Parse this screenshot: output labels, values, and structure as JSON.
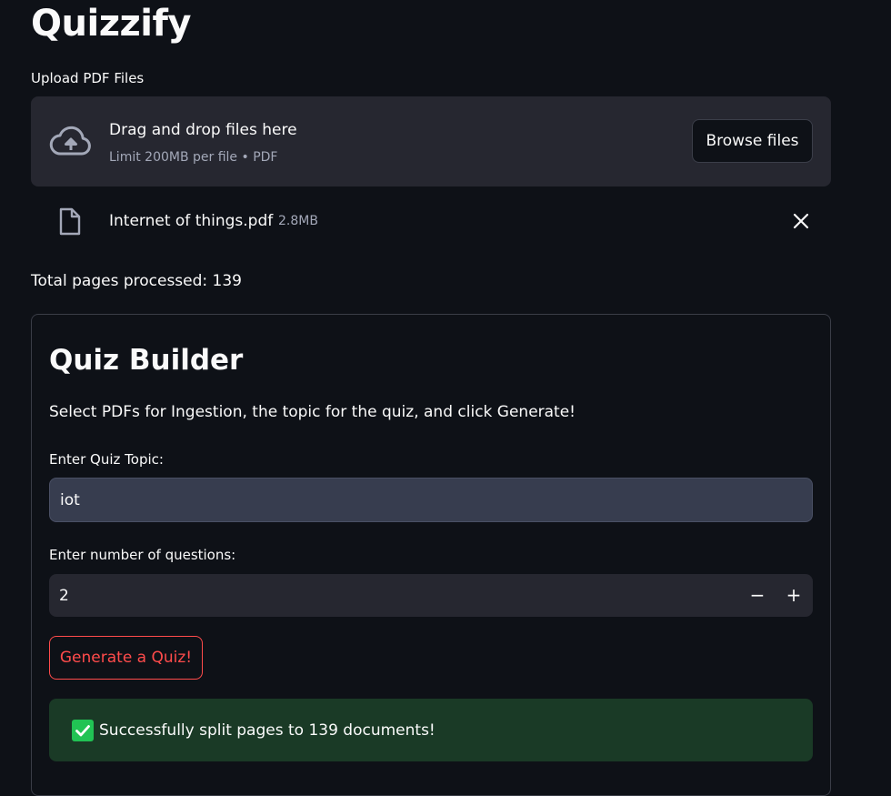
{
  "app": {
    "title": "Quizzify"
  },
  "uploader": {
    "label": "Upload PDF Files",
    "drop_title": "Drag and drop files here",
    "drop_limit": "Limit 200MB per file • PDF",
    "browse_label": "Browse files",
    "icon": "cloud-upload-icon"
  },
  "uploaded_file": {
    "name": "Internet of things.pdf",
    "size": "2.8MB",
    "icon": "file-icon",
    "remove_icon": "close-icon"
  },
  "status": {
    "pages_processed": "Total pages processed: 139"
  },
  "quiz_builder": {
    "title": "Quiz Builder",
    "description": "Select PDFs for Ingestion, the topic for the quiz, and click Generate!",
    "topic_label": "Enter Quiz Topic:",
    "topic_value": "iot",
    "questions_label": "Enter number of questions:",
    "questions_value": "2",
    "decrement_symbol": "−",
    "increment_symbol": "+",
    "generate_label": "Generate a Quiz!",
    "success_message": "Successfully split pages to 139 documents!",
    "success_icon": "check-mark-icon"
  },
  "colors": {
    "background": "#0e1117",
    "surface": "#262730",
    "accent": "#ff4b4b",
    "success_bg": "#1a3a26",
    "success_check": "#21c354"
  }
}
